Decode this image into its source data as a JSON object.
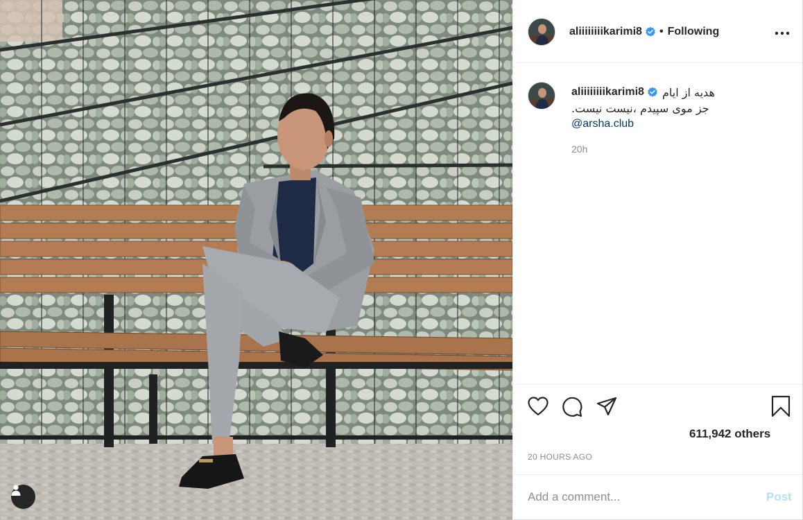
{
  "photo": {
    "subject": "man-on-bench",
    "colors": {
      "wall": "#9aa39a",
      "bench": "#b07a52",
      "suit": "#9a9ea3",
      "shirt": "#1f2a44",
      "ground": "#b9b4ad",
      "sky": "#d8c6b6"
    },
    "tag_icon": "user-icon"
  },
  "header": {
    "username": "aliiiiiiiikarimi8",
    "verified_icon": "verified-badge-icon",
    "separator": "•",
    "follow_status": "Following",
    "more_icon": "more-horizontal-icon"
  },
  "caption": {
    "username": "aliiiiiiiikarimi8",
    "line1": "هدیه از ایام",
    "line2": "جز موی سپیدم ،نیست نیست.",
    "mention": "@arsha.club",
    "time": "20h"
  },
  "actions": {
    "like_icon": "heart-icon",
    "comment_icon": "comment-icon",
    "share_icon": "paper-plane-icon",
    "save_icon": "bookmark-icon"
  },
  "likes": {
    "text": "611,942 others"
  },
  "date": "20 HOURS AGO",
  "comment": {
    "placeholder": "Add a comment...",
    "post_label": "Post",
    "accent": "#b2dffc"
  }
}
